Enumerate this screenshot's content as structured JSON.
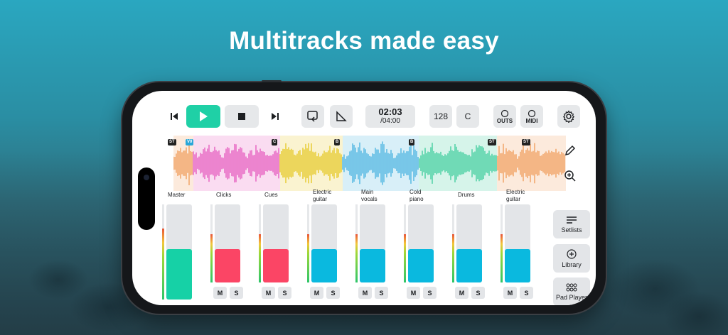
{
  "headline": "Multitracks made easy",
  "transport": {
    "time_current": "02:03",
    "time_total": "/04:00",
    "tempo": "128",
    "key": "C",
    "outs_label": "OUTS",
    "midi_label": "MIDI"
  },
  "markers": [
    "ST",
    "V0",
    "C",
    "B",
    "B",
    "ST",
    "ST"
  ],
  "channels": [
    {
      "name": "Master",
      "level": 0.53,
      "color": "#16d1a6",
      "meter": 0.75,
      "ms": false
    },
    {
      "name": "Clicks",
      "level": 0.43,
      "color": "#fb4565",
      "meter": 0.62,
      "ms": true
    },
    {
      "name": "Cues",
      "level": 0.43,
      "color": "#fb4565",
      "meter": 0.62,
      "ms": true
    },
    {
      "name": "Electric\nguitar",
      "level": 0.43,
      "color": "#0ab9df",
      "meter": 0.62,
      "ms": true
    },
    {
      "name": "Main\nvocals",
      "level": 0.43,
      "color": "#0ab9df",
      "meter": 0.62,
      "ms": true
    },
    {
      "name": "Cold\npiano",
      "level": 0.43,
      "color": "#0ab9df",
      "meter": 0.62,
      "ms": true
    },
    {
      "name": "Drums",
      "level": 0.43,
      "color": "#0ab9df",
      "meter": 0.62,
      "ms": true
    },
    {
      "name": "Electric\nguitar",
      "level": 0.43,
      "color": "#0ab9df",
      "meter": 0.62,
      "ms": true
    }
  ],
  "mute_label": "M",
  "solo_label": "S",
  "nav": {
    "setlists": "Setlists",
    "library": "Library",
    "pad_player": "Pad Player"
  },
  "colors": {
    "play": "#1fd0a6",
    "wave_segments": [
      "#f0a060",
      "#e65fc0",
      "#e6c92a",
      "#4fb6e0",
      "#45cfa0",
      "#f0a060"
    ]
  }
}
